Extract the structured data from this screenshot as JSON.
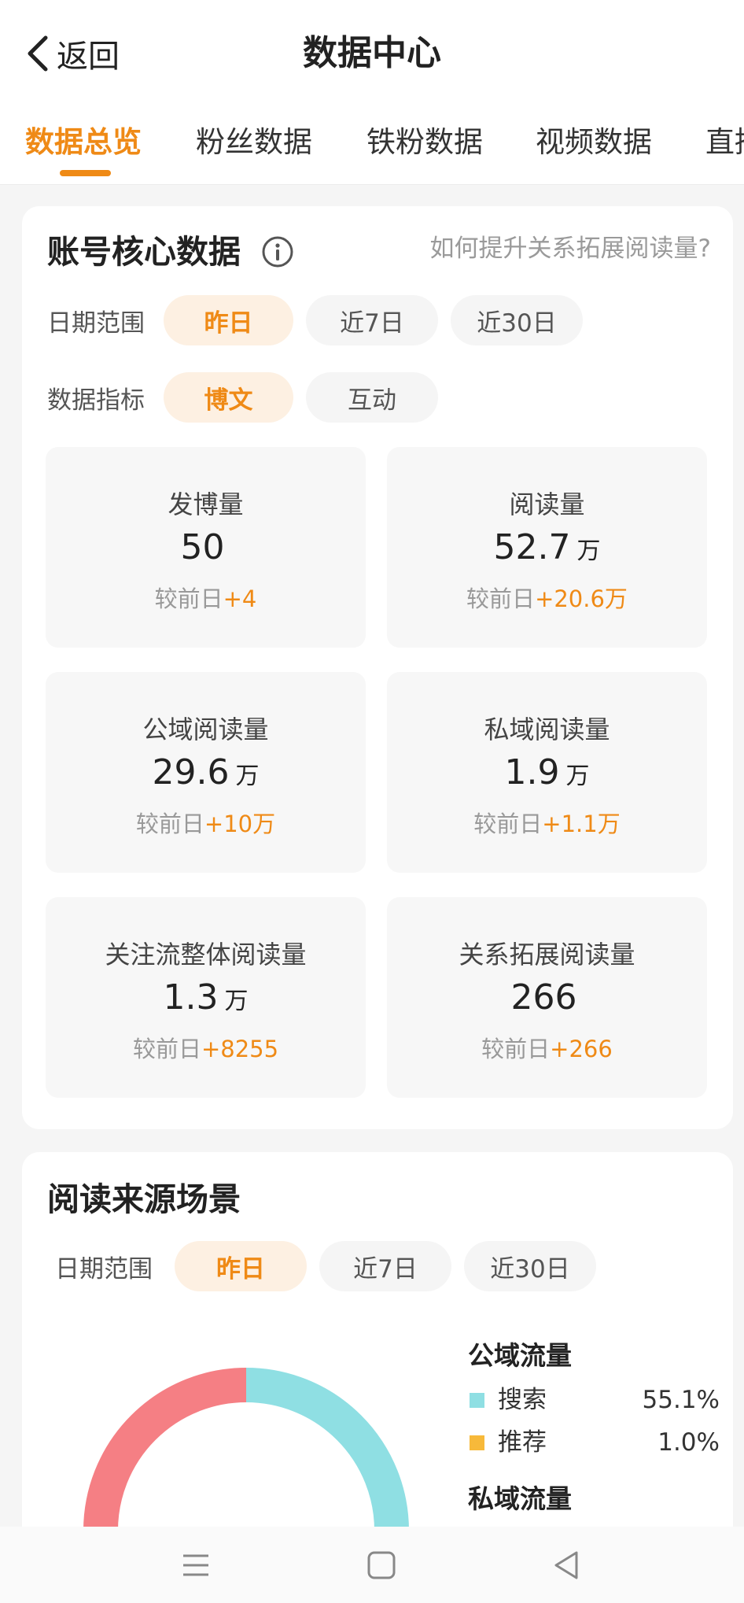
{
  "header": {
    "back_label": "返回",
    "title": "数据中心"
  },
  "tabs": [
    {
      "label": "数据总览",
      "active": true
    },
    {
      "label": "粉丝数据",
      "active": false
    },
    {
      "label": "铁粉数据",
      "active": false
    },
    {
      "label": "视频数据",
      "active": false
    },
    {
      "label": "直播",
      "active": false
    }
  ],
  "core": {
    "title": "账号核心数据",
    "help_text": "如何提升关系拓展阅读量?",
    "date_range": {
      "label": "日期范围",
      "options": [
        "昨日",
        "近7日",
        "近30日"
      ],
      "selected": "昨日"
    },
    "metric_type": {
      "label": "数据指标",
      "options": [
        "博文",
        "互动"
      ],
      "selected": "博文"
    },
    "compare_prefix": "较前日",
    "metrics": [
      {
        "label": "发博量",
        "value": "50",
        "unit": "",
        "delta": "+4"
      },
      {
        "label": "阅读量",
        "value": "52.7",
        "unit": "万",
        "delta": "+20.6万"
      },
      {
        "label": "公域阅读量",
        "value": "29.6",
        "unit": "万",
        "delta": "+10万"
      },
      {
        "label": "私域阅读量",
        "value": "1.9",
        "unit": "万",
        "delta": "+1.1万"
      },
      {
        "label": "关注流整体阅读量",
        "value": "1.3",
        "unit": "万",
        "delta": "+8255"
      },
      {
        "label": "关系拓展阅读量",
        "value": "266",
        "unit": "",
        "delta": "+266"
      }
    ]
  },
  "source": {
    "title": "阅读来源场景",
    "date_range": {
      "label": "日期范围",
      "options": [
        "昨日",
        "近7日",
        "近30日"
      ],
      "selected": "昨日"
    },
    "legend": {
      "public_title": "公域流量",
      "public_items": [
        {
          "name": "搜索",
          "value": "55.1%",
          "color": "#8fdfe3"
        },
        {
          "name": "推荐",
          "value": "1.0%",
          "color": "#f7b93a"
        }
      ],
      "private_title": "私域流量"
    },
    "donut_colors": {
      "left": "#f57f84",
      "right": "#8fdfe3"
    }
  },
  "colors": {
    "accent": "#ef8a16",
    "accent_bg": "#fdf0e2"
  }
}
